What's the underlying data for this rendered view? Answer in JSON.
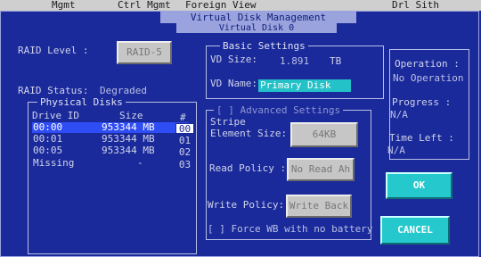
{
  "menu": {
    "items": [
      "Mgmt",
      "Ctrl Mgmt",
      "Foreign View",
      "Drl Sith"
    ]
  },
  "window": {
    "title": "Virtual Disk Management",
    "subtitle": "Virtual Disk 0"
  },
  "raid": {
    "level_label": "RAID Level :",
    "level_value": "RAID-5",
    "status_label": "RAID Status:",
    "status_value": "Degraded"
  },
  "physical_disks": {
    "legend": "Physical Disks",
    "columns": [
      "Drive ID",
      "Size",
      "#"
    ],
    "rows": [
      {
        "id": "00:00",
        "size": "953344 MB",
        "num": "00"
      },
      {
        "id": "00:01",
        "size": "953344 MB",
        "num": "01"
      },
      {
        "id": "00:05",
        "size": "953344 MB",
        "num": "02"
      },
      {
        "id": "Missing",
        "size": "-",
        "num": "03"
      }
    ]
  },
  "basic": {
    "legend": "Basic Settings",
    "vd_size_label": "VD Size:",
    "vd_size_value": "1.891",
    "vd_size_unit": "TB",
    "vd_name_label": "VD Name:",
    "vd_name_value": "Primary Disk"
  },
  "advanced": {
    "legend": "[ ] Advanced Settings",
    "stripe_label_1": "Stripe",
    "stripe_label_2": "Element Size:",
    "stripe_value": "64KB",
    "read_label": "Read Policy :",
    "read_value": "No Read Ah",
    "write_label": "Write Policy:",
    "write_value": "Write Back",
    "force_wb": "[ ] Force WB with no battery"
  },
  "operation": {
    "op_label": "Operation :",
    "op_value": "No Operation",
    "progress_label": "Progress :",
    "progress_value": "N/A",
    "time_label": "Time Left :",
    "time_value": "N/A"
  },
  "buttons": {
    "ok": "OK",
    "cancel": "CANCEL"
  }
}
